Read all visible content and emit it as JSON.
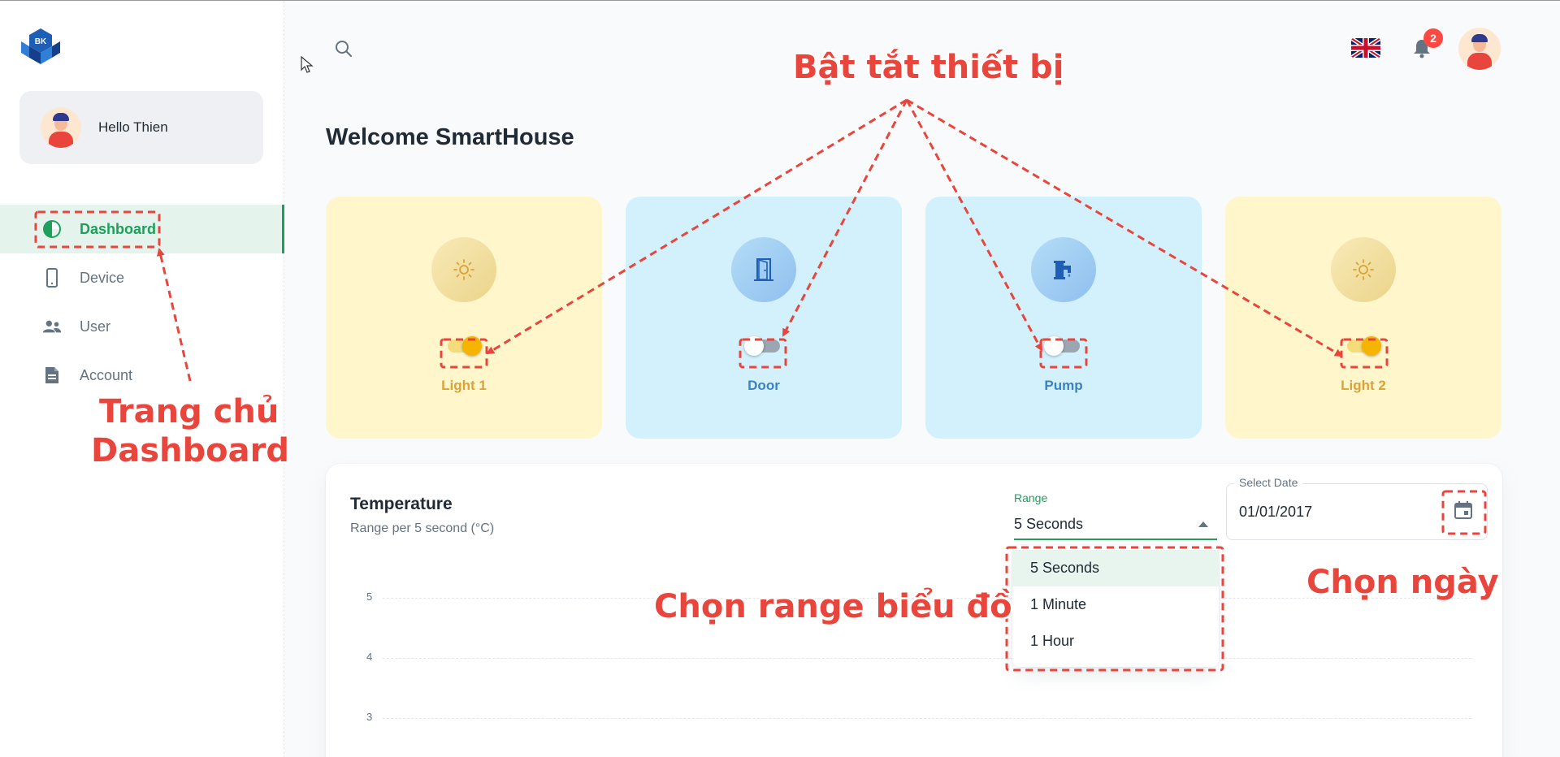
{
  "sidebar": {
    "user_name": "Hello Thien",
    "nav": [
      {
        "label": "Dashboard",
        "icon": "pie-chart-icon",
        "active": true
      },
      {
        "label": "Device",
        "icon": "phone-icon"
      },
      {
        "label": "User",
        "icon": "users-icon"
      },
      {
        "label": "Account",
        "icon": "document-icon"
      }
    ]
  },
  "header": {
    "notification_count": "2",
    "language_flag": "uk-flag-icon"
  },
  "page": {
    "title": "Welcome SmartHouse"
  },
  "devices": [
    {
      "label": "Light 1",
      "icon": "sun-icon",
      "state": "on",
      "color": "#d9a33a"
    },
    {
      "label": "Door",
      "icon": "door-icon",
      "state": "off",
      "color": "#3b82c4"
    },
    {
      "label": "Pump",
      "icon": "pump-icon",
      "state": "off",
      "color": "#3b82c4"
    },
    {
      "label": "Light 2",
      "icon": "sun-icon",
      "state": "on",
      "color": "#d9a33a"
    }
  ],
  "temperature": {
    "title": "Temperature",
    "subtitle": "Range per 5 second (°C)",
    "range_label": "Range",
    "range_value": "5 Seconds",
    "range_options": [
      "5 Seconds",
      "1 Minute",
      "1 Hour"
    ],
    "date_label": "Select Date",
    "date_value": "01/01/2017"
  },
  "chart_data": {
    "type": "line",
    "title": "Temperature",
    "subtitle": "Range per 5 second (°C)",
    "y_ticks": [
      "5",
      "4",
      "3"
    ],
    "series": []
  },
  "annotations": {
    "toggle_devices": "Bật tắt thiết bị",
    "home_line1": "Trang chủ",
    "home_line2": "Dashboard",
    "chart_range": "Chọn range biểu đồ",
    "pick_date": "Chọn ngày"
  },
  "colors": {
    "primary": "#1ea05a",
    "annotation": "#e8453c",
    "light_card": "#fff6cc",
    "blue_card": "#d2f1fd"
  }
}
